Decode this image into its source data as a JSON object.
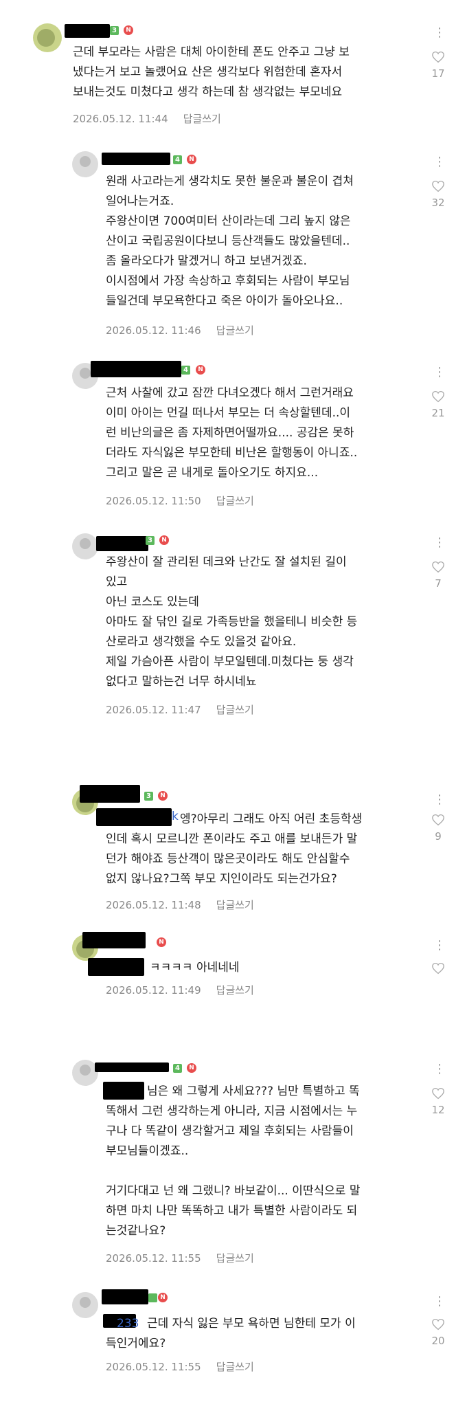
{
  "comments": [
    {
      "level": "3",
      "new": "N",
      "text": "근데 부모라는 사람은 대체 아이한테 폰도 안주고 그냥 보\n냈다는거 보고 놀랬어요 산은 생각보다 위험한데 혼자서\n보내는것도 미쳤다고 생각 하는데 참 생각없는 부모네요",
      "time": "2026.05.12. 11:44",
      "reply": "답글쓰기",
      "likes": "17"
    },
    {
      "level": "4",
      "new": "N",
      "text": "원래 사고라는게 생각치도 못한 불운과 불운이 겹쳐\n일어나는거죠.\n주왕산이면 700여미터 산이라는데 그리 높지 않은\n산이고 국립공원이다보니 등산객들도 많았을텐데..\n좀 올라오다가 말겠거니 하고 보낸거겠죠.\n이시점에서 가장 속상하고 후회되는 사람이 부모님\n들일건데 부모욕한다고 죽은 아이가 돌아오나요..",
      "time": "2026.05.12. 11:46",
      "reply": "답글쓰기",
      "likes": "32"
    },
    {
      "level": "4",
      "new": "N",
      "text": "근처 사찰에 갔고 잠깐 다녀오겠다 해서 그런거래요\n이미 아이는 먼길 떠나서 부모는 더 속상할텐데..이\n런 비난의글은 좀 자제하면어떨까요.... 공감은 못하\n더라도 자식잃은 부모한테 비난은 할행동이 아니죠..\n그리고 말은 곧 내게로 돌아오기도 하지요...",
      "time": "2026.05.12. 11:50",
      "reply": "답글쓰기",
      "likes": "21"
    },
    {
      "level": "3",
      "new": "N",
      "text": "주왕산이 잘 관리된 데크와 난간도 잘 설치된 길이\n있고\n아닌 코스도 있는데\n아마도 잘 닦인 길로 가족등반을 했을테니 비슷한 등\n산로라고 생각했을 수도 있을것 같아요.\n제일 가슴아픈 사람이 부모일텐데.미쳤다는 둥 생각\n없다고 말하는건 너무 하시네뇨",
      "time": "2026.05.12. 11:47",
      "reply": "답글쓰기",
      "likes": "7"
    },
    {
      "level": "3",
      "new": "N",
      "mention": "k",
      "text": "엥?아무리 그래도 아직 어린 초등학생\n인데 혹시 모르니깐 폰이라도 주고 애를 보내든가 말\n던가 해야죠 등산객이 많은곳이라도 해도 안심할수\n없지 않나요?그쪽 부모 지인이라도 되는건가요?",
      "time": "2026.05.12. 11:48",
      "reply": "답글쓰기",
      "likes": "9"
    },
    {
      "new": "N",
      "text": "ㅋㅋㅋㅋ 아네네네",
      "time": "2026.05.12. 11:49",
      "reply": "답글쓰기",
      "likes": ""
    },
    {
      "level": "4",
      "new": "N",
      "text": "님은 왜 그렇게 사세요??? 님만 특별하고 똑\n똑해서 그런 생각하는게 아니라, 지금 시점에서는 누\n구나 다 똑같이 생각할거고 제일 후회되는 사람들이\n부모님들이겠죠..\n\n거기다대고 넌 왜 그랬니? 바보같이... 이딴식으로 말\n하면 마치 나만 똑똑하고 내가 특별한 사람이라도 되\n는것같나요?",
      "time": "2026.05.12. 11:55",
      "reply": "답글쓰기",
      "likes": "12"
    },
    {
      "new": "N",
      "mention": "233",
      "text": "근데 자식 잃은 부모 욕하면 님한테 모가 이\n득인거에요?",
      "time": "2026.05.12. 11:55",
      "reply": "답글쓰기",
      "likes": "20"
    }
  ]
}
